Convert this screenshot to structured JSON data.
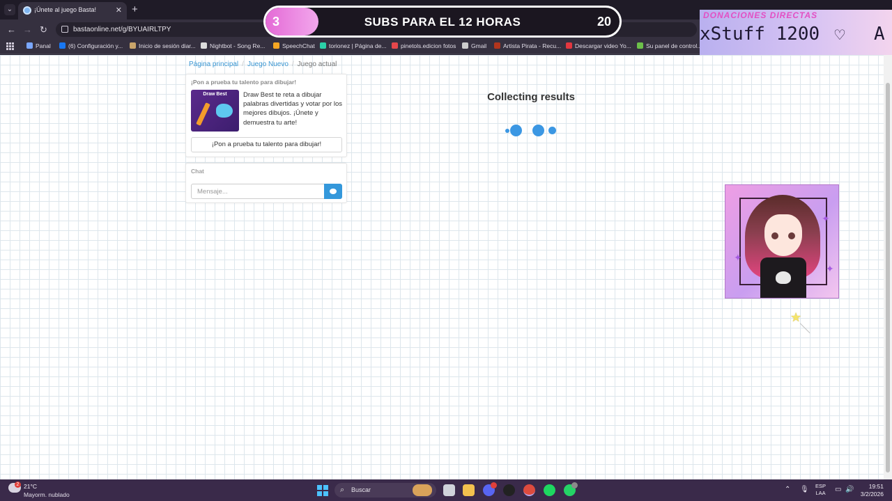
{
  "browser": {
    "tab_title": "¡Únete al juego Basta!",
    "url": "bastaonline.net/g/BYUAIRLTPY",
    "bookmarks": [
      {
        "label": "Panal",
        "color": "#7aa7ff"
      },
      {
        "label": "(6) Configuración y...",
        "color": "#1877f2"
      },
      {
        "label": "Inicio de sesión diar...",
        "color": "#c9a46a"
      },
      {
        "label": "Nightbot - Song Re...",
        "color": "#dcdcdc"
      },
      {
        "label": "SpeechChat",
        "color": "#f5a623"
      },
      {
        "label": "torionez | Página de...",
        "color": "#2bd1a8"
      },
      {
        "label": "pinetols.edicion fotos",
        "color": "#e5474b"
      },
      {
        "label": "Gmail",
        "color": "#cccccc"
      },
      {
        "label": "Artista Pirata - Recu...",
        "color": "#b1351d"
      },
      {
        "label": "Descargar video Yo...",
        "color": "#e2373f"
      },
      {
        "label": "Su panel de control...",
        "color": "#6cc04a"
      }
    ]
  },
  "overlay": {
    "subs_current": "3",
    "subs_label": "SUBS PARA EL 12 HORAS",
    "subs_goal": "20",
    "subs_progress": 0.15,
    "donations_header": "DONACIONES DIRECTAS",
    "donations_ticker": "xStuff 1200",
    "donations_tail": "A"
  },
  "page": {
    "breadcrumb": {
      "home": "Página principal",
      "new_game": "Juego Nuevo",
      "current": "Juego actual"
    },
    "promo": {
      "title": "¡Pon a prueba tu talento para dibujar!",
      "thumb_title": "Draw Best",
      "description": "Draw Best te reta a dibujar palabras divertidas y votar por los mejores dibujos. ¡Únete y demuestra tu arte!",
      "button": "¡Pon a prueba tu talento para dibujar!"
    },
    "chat": {
      "title": "Chat",
      "placeholder": "Mensaje..."
    },
    "status": "Collecting results"
  },
  "taskbar": {
    "temperature": "21°C",
    "condition": "Mayorm. nublado",
    "weather_badge": "2",
    "search": "Buscar",
    "lang_top": "ESP",
    "lang_bottom": "LAA",
    "time": "19:51",
    "date": "3/2/2026"
  },
  "colors": {
    "accent": "#3b97e3",
    "link": "#3b97d3",
    "taskbar": "#3a2a4a"
  }
}
